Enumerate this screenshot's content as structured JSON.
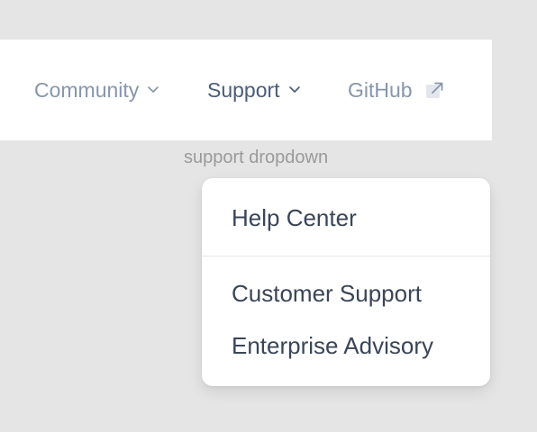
{
  "nav": {
    "items": [
      {
        "label": "Community",
        "icon": "chevron-down-icon"
      },
      {
        "label": "Support",
        "icon": "chevron-down-icon"
      },
      {
        "label": "GitHub",
        "icon": "external-link-icon"
      }
    ]
  },
  "caption": "support dropdown",
  "dropdown": {
    "items": [
      {
        "label": "Help Center"
      },
      {
        "label": "Customer Support"
      },
      {
        "label": "Enterprise Advisory"
      }
    ]
  },
  "colors": {
    "background": "#e5e5e5",
    "nav_muted": "#8796ab",
    "nav_active": "#4a5d78",
    "dropdown_text": "#3a4558",
    "caption": "#9a9a9a"
  }
}
